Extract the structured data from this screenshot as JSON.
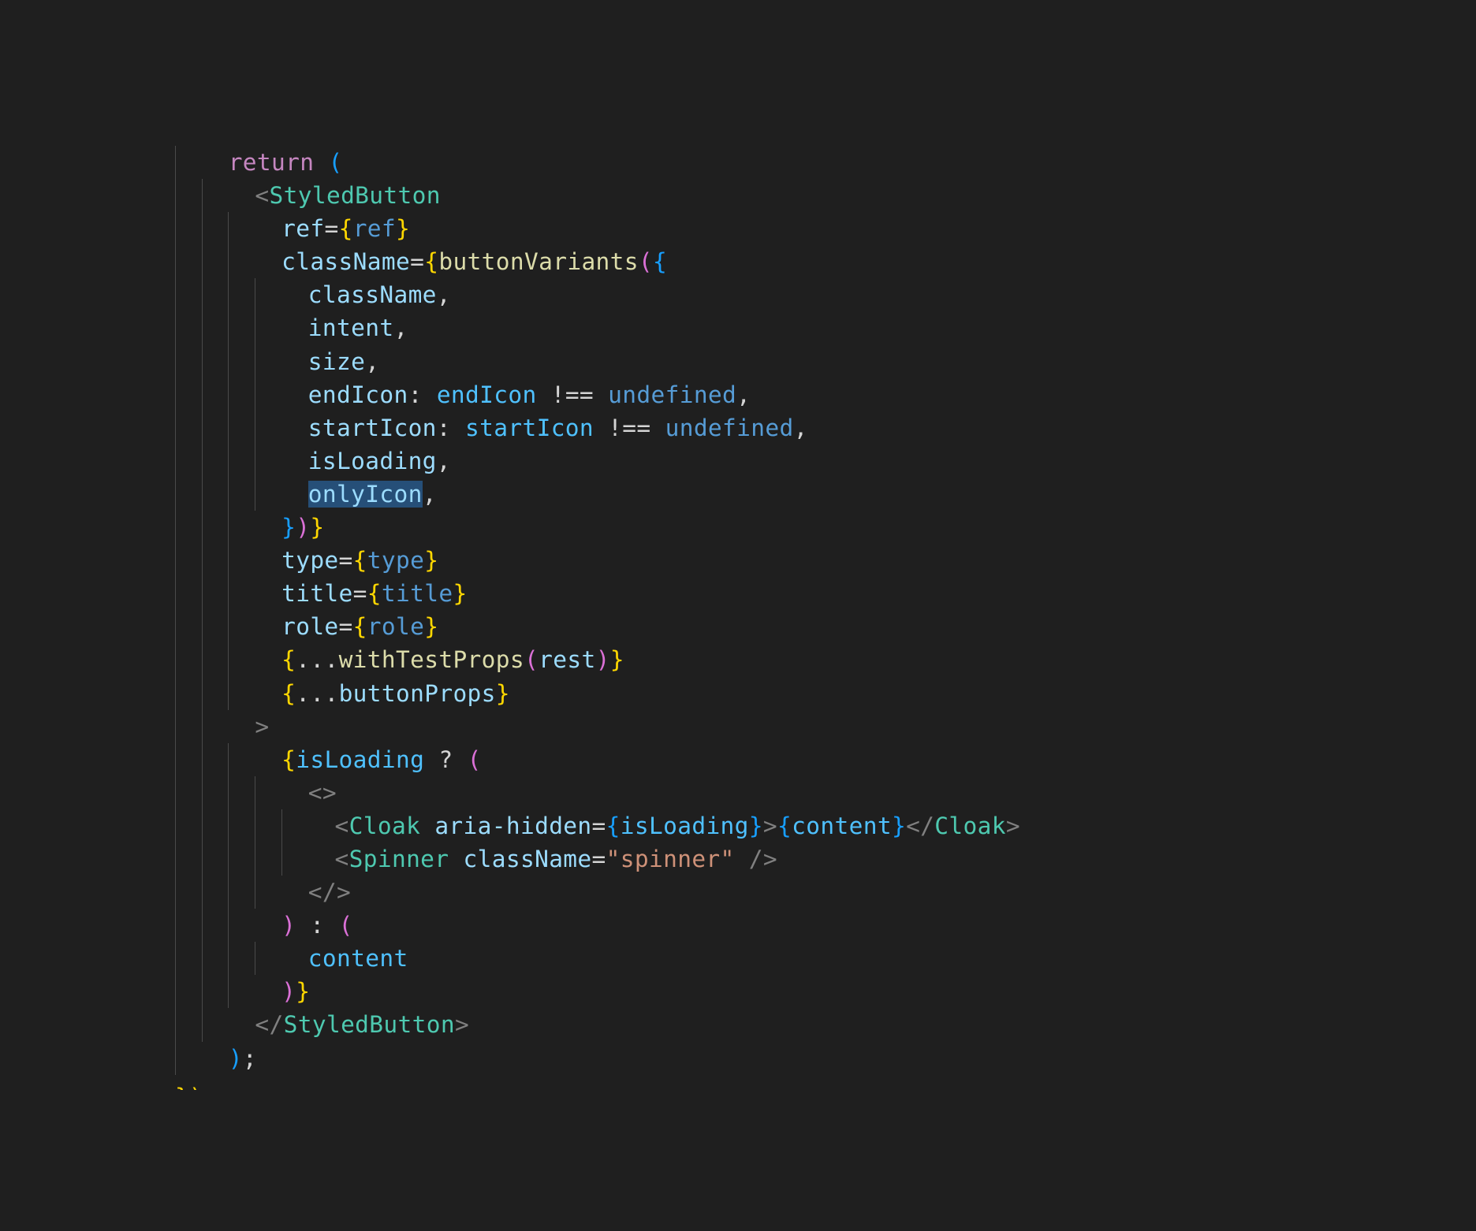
{
  "colors": {
    "background": "#1f1f1f",
    "keyword": "#c586c0",
    "variable": "#9cdcfe",
    "tag": "#4ec9b0",
    "tag_bracket": "#808080",
    "function": "#dcdcaa",
    "constant": "#569cd6",
    "string": "#ce9178",
    "punctuation": "#d4d4d4",
    "bracket_gold": "#ffd700",
    "bracket_pink": "#da70d6",
    "bracket_blue": "#179fff",
    "selection": "#264f78"
  },
  "code_lines": [
    {
      "indent": 1,
      "segments": [
        {
          "t": "return",
          "c": "#c586c0"
        },
        {
          "t": " ",
          "c": "#d4d4d4"
        },
        {
          "t": "(",
          "c": "#179fff"
        }
      ]
    },
    {
      "indent": 2,
      "segments": [
        {
          "t": "<",
          "c": "#808080"
        },
        {
          "t": "StyledButton",
          "c": "#4ec9b0"
        }
      ]
    },
    {
      "indent": 3,
      "segments": [
        {
          "t": "ref",
          "c": "#9cdcfe"
        },
        {
          "t": "=",
          "c": "#d4d4d4"
        },
        {
          "t": "{",
          "c": "#ffd700"
        },
        {
          "t": "ref",
          "c": "#569cd6"
        },
        {
          "t": "}",
          "c": "#ffd700"
        }
      ]
    },
    {
      "indent": 3,
      "segments": [
        {
          "t": "className",
          "c": "#9cdcfe"
        },
        {
          "t": "=",
          "c": "#d4d4d4"
        },
        {
          "t": "{",
          "c": "#ffd700"
        },
        {
          "t": "buttonVariants",
          "c": "#dcdcaa"
        },
        {
          "t": "(",
          "c": "#da70d6"
        },
        {
          "t": "{",
          "c": "#179fff"
        }
      ]
    },
    {
      "indent": 4,
      "segments": [
        {
          "t": "className",
          "c": "#9cdcfe"
        },
        {
          "t": ",",
          "c": "#d4d4d4"
        }
      ]
    },
    {
      "indent": 4,
      "segments": [
        {
          "t": "intent",
          "c": "#9cdcfe"
        },
        {
          "t": ",",
          "c": "#d4d4d4"
        }
      ]
    },
    {
      "indent": 4,
      "segments": [
        {
          "t": "size",
          "c": "#9cdcfe"
        },
        {
          "t": ",",
          "c": "#d4d4d4"
        }
      ]
    },
    {
      "indent": 4,
      "segments": [
        {
          "t": "endIcon",
          "c": "#9cdcfe"
        },
        {
          "t": ": ",
          "c": "#d4d4d4"
        },
        {
          "t": "endIcon",
          "c": "#4fc1ff"
        },
        {
          "t": " !== ",
          "c": "#d4d4d4"
        },
        {
          "t": "undefined",
          "c": "#569cd6"
        },
        {
          "t": ",",
          "c": "#d4d4d4"
        }
      ]
    },
    {
      "indent": 4,
      "segments": [
        {
          "t": "startIcon",
          "c": "#9cdcfe"
        },
        {
          "t": ": ",
          "c": "#d4d4d4"
        },
        {
          "t": "startIcon",
          "c": "#4fc1ff"
        },
        {
          "t": " !== ",
          "c": "#d4d4d4"
        },
        {
          "t": "undefined",
          "c": "#569cd6"
        },
        {
          "t": ",",
          "c": "#d4d4d4"
        }
      ]
    },
    {
      "indent": 4,
      "segments": [
        {
          "t": "isLoading",
          "c": "#9cdcfe"
        },
        {
          "t": ",",
          "c": "#d4d4d4"
        }
      ]
    },
    {
      "indent": 4,
      "segments": [
        {
          "t": "onlyIcon",
          "c": "#9cdcfe",
          "sel": true
        },
        {
          "t": ",",
          "c": "#d4d4d4"
        }
      ]
    },
    {
      "indent": 3,
      "segments": [
        {
          "t": "}",
          "c": "#179fff"
        },
        {
          "t": ")",
          "c": "#da70d6"
        },
        {
          "t": "}",
          "c": "#ffd700"
        }
      ]
    },
    {
      "indent": 3,
      "segments": [
        {
          "t": "type",
          "c": "#9cdcfe"
        },
        {
          "t": "=",
          "c": "#d4d4d4"
        },
        {
          "t": "{",
          "c": "#ffd700"
        },
        {
          "t": "type",
          "c": "#569cd6"
        },
        {
          "t": "}",
          "c": "#ffd700"
        }
      ]
    },
    {
      "indent": 3,
      "segments": [
        {
          "t": "title",
          "c": "#9cdcfe"
        },
        {
          "t": "=",
          "c": "#d4d4d4"
        },
        {
          "t": "{",
          "c": "#ffd700"
        },
        {
          "t": "title",
          "c": "#569cd6"
        },
        {
          "t": "}",
          "c": "#ffd700"
        }
      ]
    },
    {
      "indent": 3,
      "segments": [
        {
          "t": "role",
          "c": "#9cdcfe"
        },
        {
          "t": "=",
          "c": "#d4d4d4"
        },
        {
          "t": "{",
          "c": "#ffd700"
        },
        {
          "t": "role",
          "c": "#569cd6"
        },
        {
          "t": "}",
          "c": "#ffd700"
        }
      ]
    },
    {
      "indent": 3,
      "segments": [
        {
          "t": "{",
          "c": "#ffd700"
        },
        {
          "t": "...",
          "c": "#d4d4d4"
        },
        {
          "t": "withTestProps",
          "c": "#dcdcaa"
        },
        {
          "t": "(",
          "c": "#da70d6"
        },
        {
          "t": "rest",
          "c": "#9cdcfe"
        },
        {
          "t": ")",
          "c": "#da70d6"
        },
        {
          "t": "}",
          "c": "#ffd700"
        }
      ]
    },
    {
      "indent": 3,
      "segments": [
        {
          "t": "{",
          "c": "#ffd700"
        },
        {
          "t": "...",
          "c": "#d4d4d4"
        },
        {
          "t": "buttonProps",
          "c": "#9cdcfe"
        },
        {
          "t": "}",
          "c": "#ffd700"
        }
      ]
    },
    {
      "indent": 2,
      "segments": [
        {
          "t": ">",
          "c": "#808080"
        }
      ]
    },
    {
      "indent": 3,
      "segments": [
        {
          "t": "{",
          "c": "#ffd700"
        },
        {
          "t": "isLoading",
          "c": "#4fc1ff"
        },
        {
          "t": " ? ",
          "c": "#d4d4d4"
        },
        {
          "t": "(",
          "c": "#da70d6"
        }
      ]
    },
    {
      "indent": 4,
      "segments": [
        {
          "t": "<>",
          "c": "#808080"
        }
      ]
    },
    {
      "indent": 5,
      "segments": [
        {
          "t": "<",
          "c": "#808080"
        },
        {
          "t": "Cloak",
          "c": "#4ec9b0"
        },
        {
          "t": " ",
          "c": "#d4d4d4"
        },
        {
          "t": "aria-hidden",
          "c": "#9cdcfe"
        },
        {
          "t": "=",
          "c": "#d4d4d4"
        },
        {
          "t": "{",
          "c": "#179fff"
        },
        {
          "t": "isLoading",
          "c": "#4fc1ff"
        },
        {
          "t": "}",
          "c": "#179fff"
        },
        {
          "t": ">",
          "c": "#808080"
        },
        {
          "t": "{",
          "c": "#179fff"
        },
        {
          "t": "content",
          "c": "#4fc1ff"
        },
        {
          "t": "}",
          "c": "#179fff"
        },
        {
          "t": "</",
          "c": "#808080"
        },
        {
          "t": "Cloak",
          "c": "#4ec9b0"
        },
        {
          "t": ">",
          "c": "#808080"
        }
      ]
    },
    {
      "indent": 5,
      "segments": [
        {
          "t": "<",
          "c": "#808080"
        },
        {
          "t": "Spinner",
          "c": "#4ec9b0"
        },
        {
          "t": " ",
          "c": "#d4d4d4"
        },
        {
          "t": "className",
          "c": "#9cdcfe"
        },
        {
          "t": "=",
          "c": "#d4d4d4"
        },
        {
          "t": "\"spinner\"",
          "c": "#ce9178"
        },
        {
          "t": " />",
          "c": "#808080"
        }
      ]
    },
    {
      "indent": 4,
      "segments": [
        {
          "t": "</>",
          "c": "#808080"
        }
      ]
    },
    {
      "indent": 3,
      "segments": [
        {
          "t": ")",
          "c": "#da70d6"
        },
        {
          "t": " : ",
          "c": "#d4d4d4"
        },
        {
          "t": "(",
          "c": "#da70d6"
        }
      ]
    },
    {
      "indent": 4,
      "segments": [
        {
          "t": "content",
          "c": "#4fc1ff"
        }
      ]
    },
    {
      "indent": 3,
      "segments": [
        {
          "t": ")",
          "c": "#da70d6"
        },
        {
          "t": "}",
          "c": "#ffd700"
        }
      ]
    },
    {
      "indent": 2,
      "segments": [
        {
          "t": "</",
          "c": "#808080"
        },
        {
          "t": "StyledButton",
          "c": "#4ec9b0"
        },
        {
          "t": ">",
          "c": "#808080"
        }
      ]
    },
    {
      "indent": 1,
      "segments": [
        {
          "t": ")",
          "c": "#179fff"
        },
        {
          "t": ";",
          "c": "#d4d4d4"
        }
      ]
    }
  ],
  "cutoff_line": "})"
}
